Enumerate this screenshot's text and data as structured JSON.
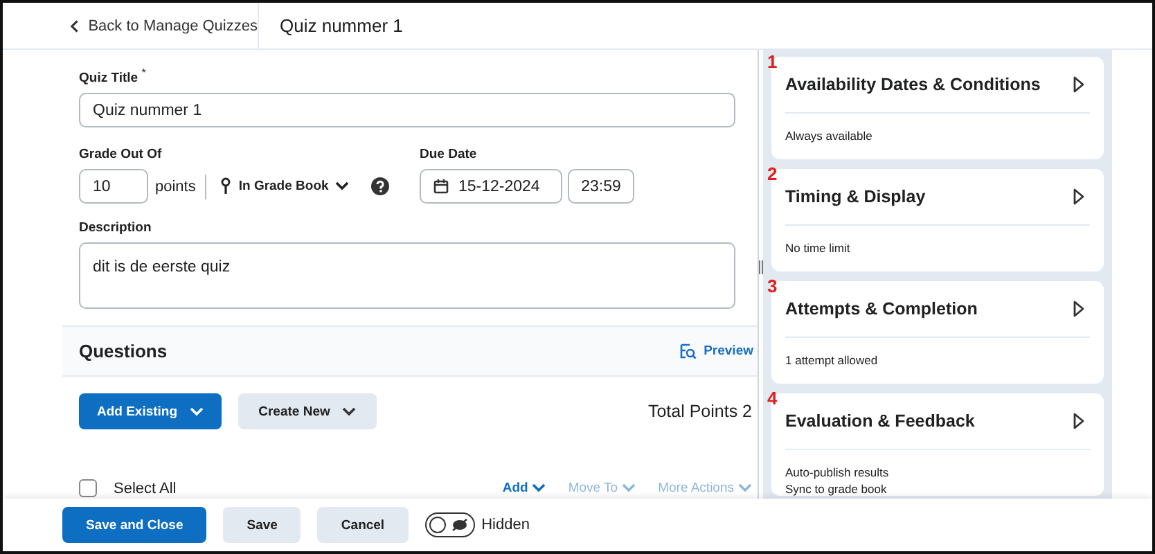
{
  "header": {
    "back_link": "Back to Manage Quizzes",
    "title": "Quiz nummer 1"
  },
  "form": {
    "title_label": "Quiz Title",
    "required_mark": "*",
    "title_value": "Quiz nummer 1",
    "grade_label": "Grade Out Of",
    "grade_value": "10",
    "grade_unit": "points",
    "grade_book": "In Grade Book",
    "due_label": "Due Date",
    "due_date": "15-12-2024",
    "due_time": "23:59",
    "description_label": "Description",
    "description_value": "dit is de eerste quiz"
  },
  "questions": {
    "title": "Questions",
    "preview": "Preview",
    "add_existing": "Add Existing",
    "create_new": "Create New",
    "total_points": "Total Points 2",
    "select_all": "Select All",
    "select_all_checked": false,
    "actions": [
      {
        "label": "Add",
        "disabled": false
      },
      {
        "label": "Move To",
        "disabled": true
      },
      {
        "label": "More Actions",
        "disabled": true
      }
    ]
  },
  "panels": [
    {
      "number": "1",
      "title": "Availability Dates & Conditions",
      "summary": [
        "Always available"
      ]
    },
    {
      "number": "2",
      "title": "Timing & Display",
      "summary": [
        "No time limit"
      ]
    },
    {
      "number": "3",
      "title": "Attempts & Completion",
      "summary": [
        "1 attempt allowed"
      ]
    },
    {
      "number": "4",
      "title": "Evaluation & Feedback",
      "summary": [
        "Auto-publish results",
        "Sync to grade book"
      ]
    }
  ],
  "footer": {
    "save_close": "Save and Close",
    "save": "Save",
    "cancel": "Cancel",
    "visibility_on": false,
    "visibility_label": "Hidden"
  }
}
